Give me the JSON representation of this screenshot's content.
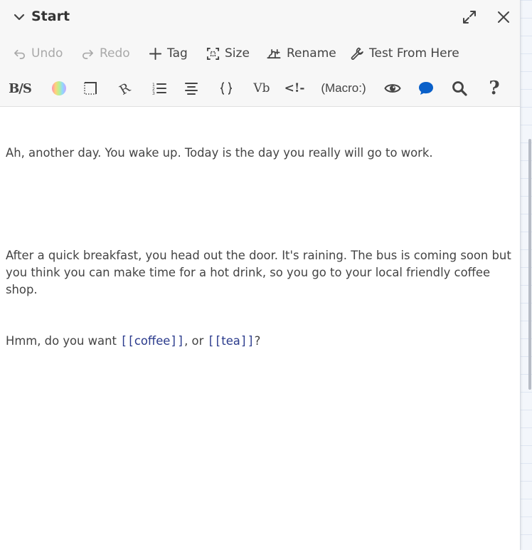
{
  "passage": {
    "title": "Start"
  },
  "toolbar": {
    "undo_label": "Undo",
    "redo_label": "Redo",
    "tag_label": "Tag",
    "size_label": "Size",
    "rename_label": "Rename",
    "test_label": "Test From Here"
  },
  "format_toolbar": {
    "bold_strike_label": "B/S",
    "verbatim_label": "Vb",
    "comment_label": "<!-",
    "macro_label": "(Macro:)",
    "help_label": "?"
  },
  "editor": {
    "line1": "Ah, another day. You wake up. Today is the day you really will go to work.",
    "line2": "After a quick breakfast, you head out the door. It's raining. The bus is coming soon but you think you can make time for a hot drink, so you go to your local friendly coffee shop.",
    "line3_prefix": "Hmm, do you want ",
    "link1": "coffee",
    "line3_middle": ", or ",
    "link2": "tea",
    "line3_suffix": "?"
  },
  "colors": {
    "accent_blue": "#0a60c9",
    "link": "#2a3a8c",
    "disabled": "#a9a9a9"
  }
}
